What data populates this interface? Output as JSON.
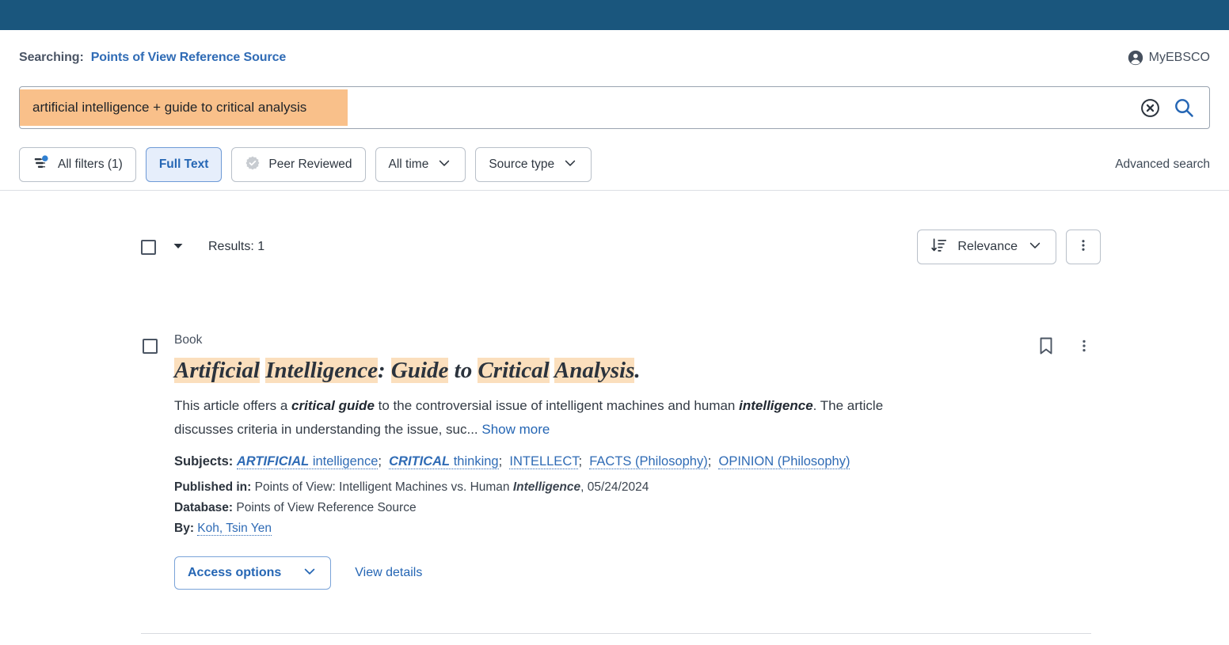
{
  "theme": {
    "brand_bar": "#1a567d",
    "link_blue": "#2566b4",
    "highlight_orange": "#fbdfbd",
    "selection_orange": "#f9c08a",
    "active_chip_bg": "#e6eefb"
  },
  "header": {
    "searching_label": "Searching:",
    "database": "Points of View Reference Source",
    "account_label": "MyEBSCO",
    "account_icon": "account-circle-icon"
  },
  "search": {
    "query": "artificial intelligence + guide to critical analysis",
    "placeholder": "",
    "clear_icon": "clear-circle-icon",
    "search_icon": "search-icon"
  },
  "filters": {
    "all_filters": {
      "label": "All filters (1)",
      "icon": "filter-icon",
      "badge": true
    },
    "chips": [
      {
        "label": "Full Text",
        "active": true,
        "icon": null,
        "chevron": false
      },
      {
        "label": "Peer Reviewed",
        "active": false,
        "icon": "peer-reviewed-badge-icon",
        "chevron": false
      },
      {
        "label": "All time",
        "active": false,
        "icon": null,
        "chevron": true
      },
      {
        "label": "Source type",
        "active": false,
        "icon": null,
        "chevron": true
      }
    ],
    "advanced_search": "Advanced search"
  },
  "results_header": {
    "count_label": "Results: 1",
    "select_all_caret": "chevron-down-icon",
    "sort": {
      "label": "Relevance",
      "icon": "sort-descending-icon",
      "chevron": "chevron-down-icon"
    },
    "more_options_icon": "kebab-menu-icon"
  },
  "result": {
    "type": "Book",
    "title_parts": [
      {
        "text": "Artificial",
        "hl": true
      },
      {
        "text": " ",
        "hl": false
      },
      {
        "text": "Intelligence",
        "hl": true
      },
      {
        "text": ": ",
        "hl": false
      },
      {
        "text": "Guide",
        "hl": true
      },
      {
        "text": " to ",
        "hl": false
      },
      {
        "text": "Critical",
        "hl": true
      },
      {
        "text": " ",
        "hl": false
      },
      {
        "text": "Analysis",
        "hl": true
      },
      {
        "text": ".",
        "hl": false
      }
    ],
    "abstract_pre": "This article offers a ",
    "abstract_b1": "critical guide",
    "abstract_mid": " to the controversial issue of intelligent machines and human ",
    "abstract_b2": "intelligence",
    "abstract_post": ". The article discusses criteria in understanding the issue, suc...",
    "show_more": "Show more",
    "subjects_label": "Subjects:",
    "subjects": [
      {
        "strong": "ARTIFICIAL",
        "rest": " intelligence"
      },
      {
        "strong": "CRITICAL",
        "rest": " thinking"
      },
      {
        "strong": "",
        "rest": "INTELLECT"
      },
      {
        "strong": "",
        "rest": "FACTS (Philosophy)"
      },
      {
        "strong": "",
        "rest": "OPINION (Philosophy)"
      }
    ],
    "published_label": "Published in:",
    "published_pre": "Points of View: Intelligent Machines vs. Human ",
    "published_em": "Intelligence",
    "published_post": ", 05/24/2024",
    "database_label": "Database:",
    "database_value": "Points of View Reference Source",
    "by_label": "By:",
    "author": "Koh, Tsin Yen",
    "access_options": "Access options",
    "view_details": "View details",
    "bookmark_icon": "bookmark-icon",
    "more_icon": "kebab-menu-icon"
  }
}
